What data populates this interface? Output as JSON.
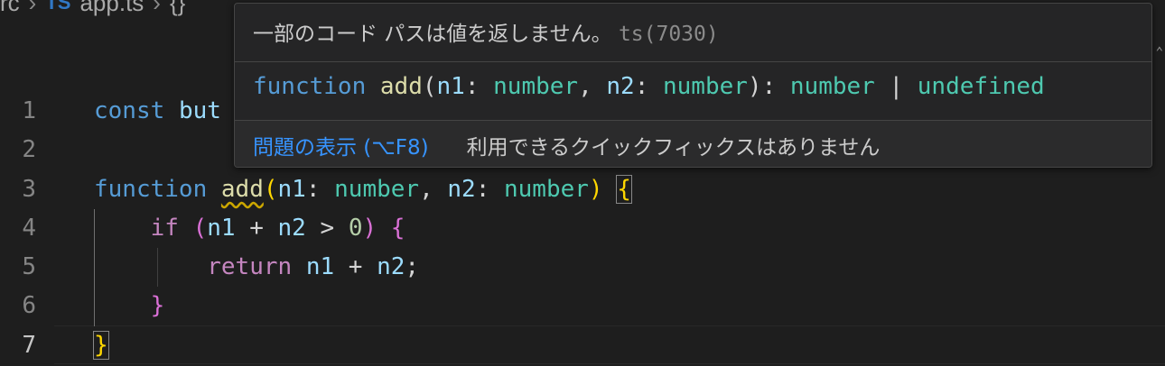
{
  "breadcrumb": {
    "folder": "rc",
    "sep": "›",
    "file_icon": "TS",
    "file": "app.ts",
    "symbol_icon": "{}"
  },
  "lines": [
    {
      "n": "1"
    },
    {
      "n": "2"
    },
    {
      "n": "3"
    },
    {
      "n": "4"
    },
    {
      "n": "5"
    },
    {
      "n": "6"
    },
    {
      "n": "7"
    }
  ],
  "code": {
    "l1_kw": "const",
    "l1_rest": "but",
    "l3_kw": "function",
    "l3_fn": "add",
    "l3_p1": "n1",
    "l3_colon1": ": ",
    "l3_t1": "number",
    "l3_comma": ", ",
    "l3_p2": "n2",
    "l3_colon2": ": ",
    "l3_t2": "number",
    "l3_paren_close": ")",
    "l3_brace": "{",
    "l4_kw": "if",
    "l4_open": "(",
    "l4_a": "n1",
    "l4_plus": " + ",
    "l4_b": "n2",
    "l4_gt": " > ",
    "l4_zero": "0",
    "l4_close": ")",
    "l4_brace": "{",
    "l5_kw": "return",
    "l5_a": "n1",
    "l5_plus": " + ",
    "l5_b": "n2",
    "l5_semi": ";",
    "l6_brace": "}",
    "l7_brace": "}"
  },
  "hover": {
    "message": "一部のコード パスは値を返しません。",
    "error_code": "ts(7030)",
    "sig_kw": "function",
    "sig_fn": "add",
    "sig_p1": "n1",
    "sig_colon1": ": ",
    "sig_t1": "number",
    "sig_comma": ", ",
    "sig_p2": "n2",
    "sig_colon2": ": ",
    "sig_t2": "number",
    "sig_close": "): ",
    "sig_ret": "number",
    "sig_pipe": " | ",
    "sig_undef": "undefined",
    "view_problem": "問題の表示 (⌥F8)",
    "no_quick_fix": "利用できるクイックフィックスはありません"
  },
  "colors": {
    "keyword": "#569cd6",
    "control": "#c586c0",
    "function": "#dcdcaa",
    "parameter": "#9cdcfe",
    "type": "#4ec9b0",
    "link": "#3794ff",
    "warning_squiggle": "#cca700"
  }
}
